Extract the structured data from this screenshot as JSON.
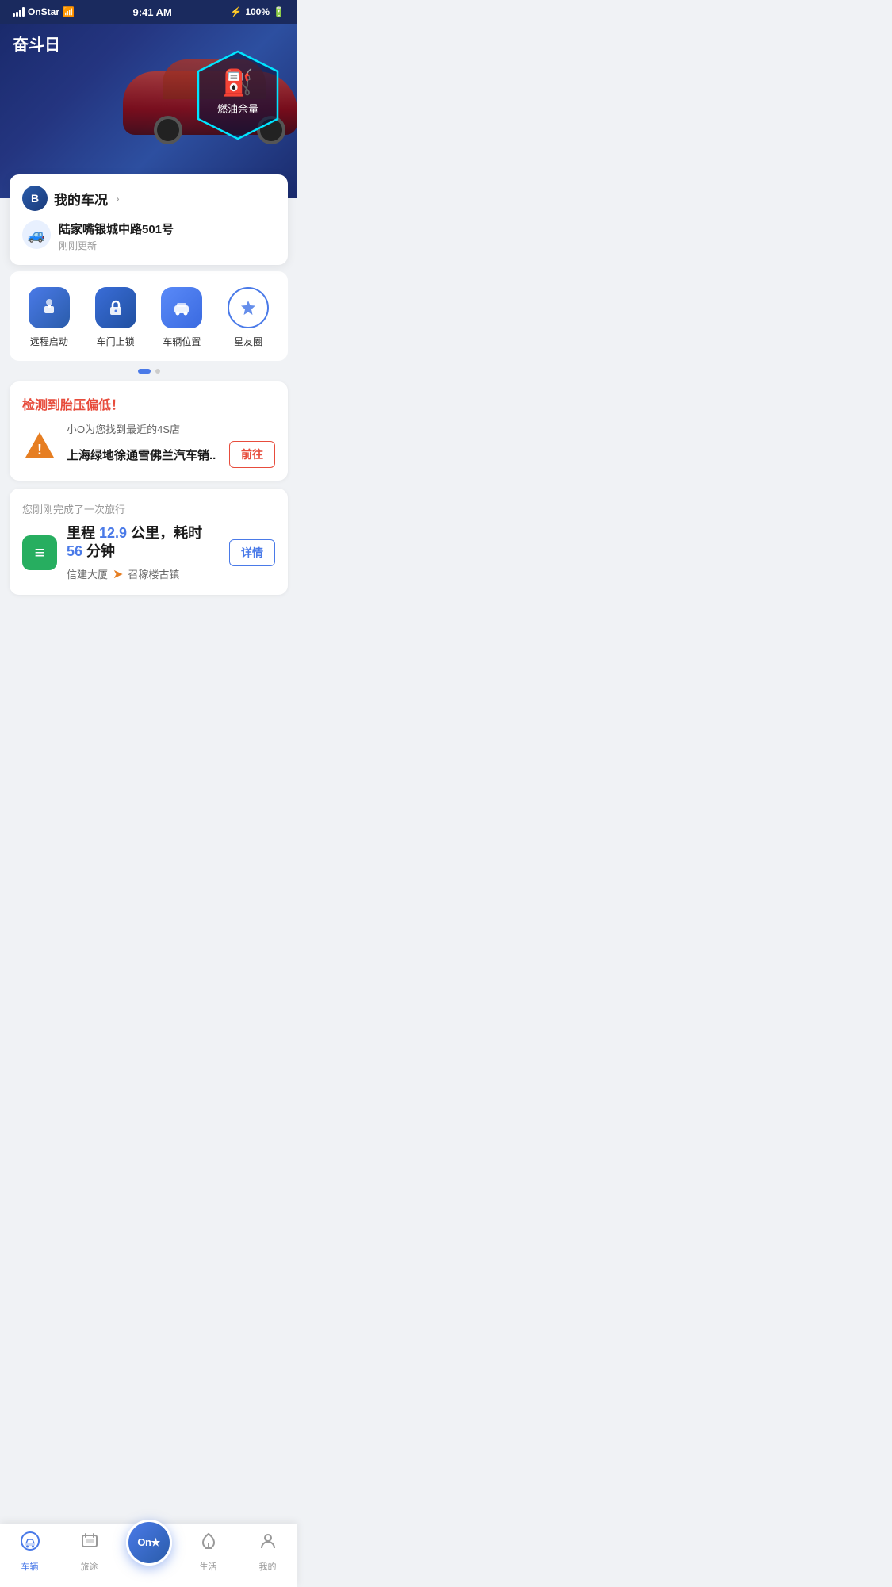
{
  "statusBar": {
    "carrier": "OnStar",
    "time": "9:41 AM",
    "battery": "100%"
  },
  "header": {
    "title": "奋斗日",
    "fuelLabel": "燃油余量"
  },
  "vehicleCard": {
    "statusLabel": "我的车况",
    "address": "陆家嘴银城中路501号",
    "updateTime": "刚刚更新"
  },
  "quickActions": [
    {
      "label": "远程启动",
      "icon": "🔑"
    },
    {
      "label": "车门上锁",
      "icon": "🔒"
    },
    {
      "label": "车辆位置",
      "icon": "🚗"
    },
    {
      "label": "星友圈",
      "icon": "⭐"
    }
  ],
  "alertCard": {
    "title": "检测到胎压偏低！",
    "subtitle": "小O为您找到最近的4S店",
    "shopName": "上海绿地徐通雪佛兰汽车销..",
    "btnLabel": "前往"
  },
  "tripCard": {
    "header": "您刚刚完成了一次旅行",
    "distanceLabel": "里程",
    "distance": "12.9",
    "distanceUnit": "公里，耗时",
    "duration": "56",
    "durationUnit": "分钟",
    "from": "信建大厦",
    "to": "召稼楼古镇",
    "btnLabel": "详情"
  },
  "tabBar": {
    "items": [
      {
        "label": "车辆",
        "active": true
      },
      {
        "label": "旅途",
        "active": false
      },
      {
        "label": "On",
        "center": true
      },
      {
        "label": "生活",
        "active": false
      },
      {
        "label": "我的",
        "active": false
      }
    ]
  }
}
